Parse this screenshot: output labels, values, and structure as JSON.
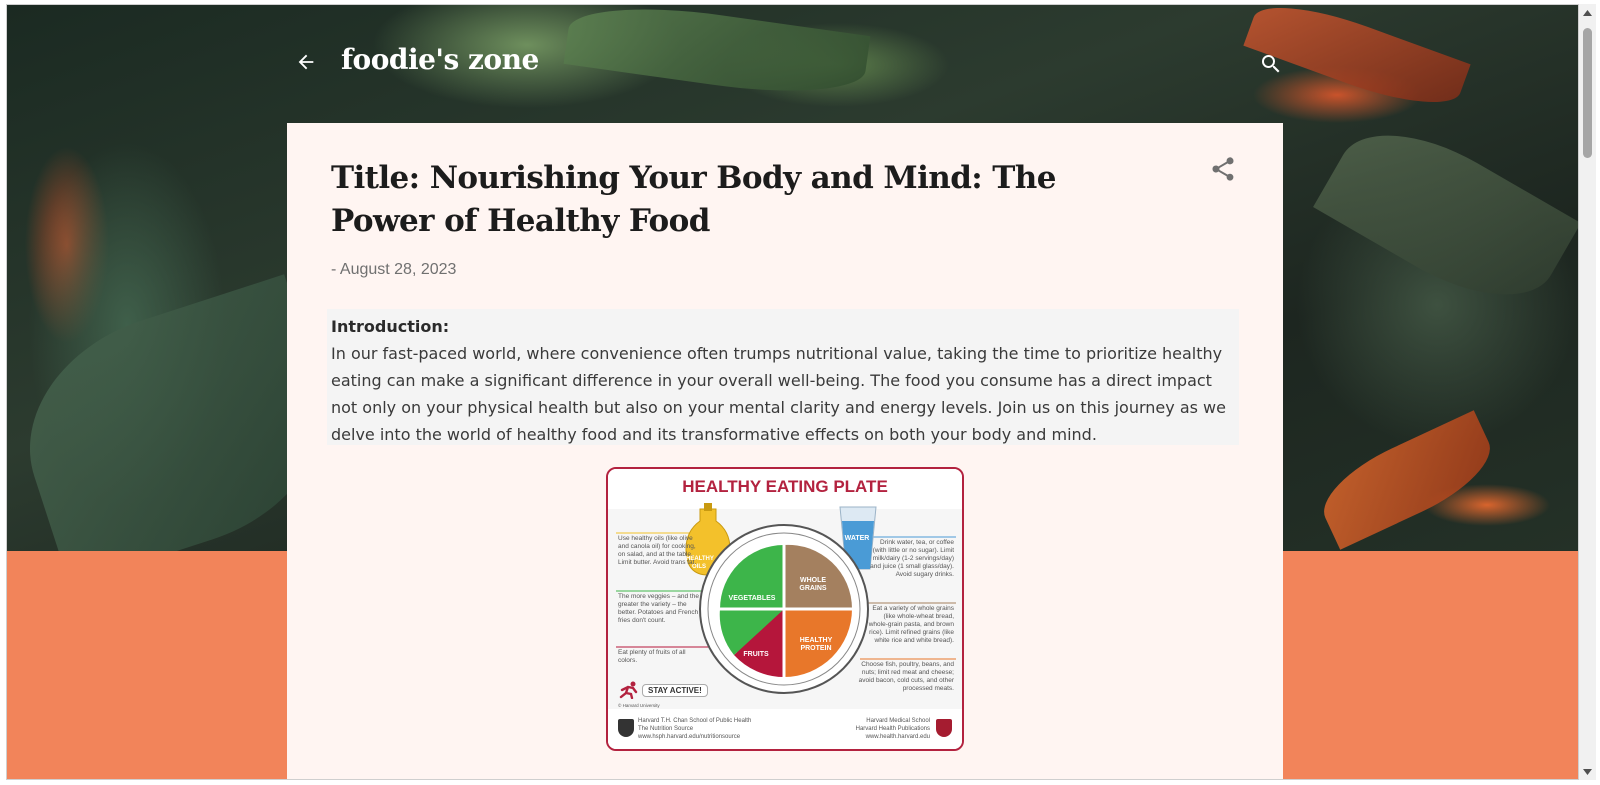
{
  "header": {
    "site_title": "foodie's zone"
  },
  "post": {
    "title": "Title: Nourishing Your Body and Mind: The Power of Healthy Food",
    "date": "- August 28, 2023",
    "intro_heading": "Introduction:",
    "intro_text": "In our fast-paced world, where convenience often trumps nutritional value, taking the time to prioritize healthy eating can make a significant difference in your overall well-being. The food you consume has a direct impact not only on your physical health but also on your mental clarity and energy levels. Join us on this journey as we delve into the world of healthy food and its transformative effects on both your body and mind."
  },
  "infographic": {
    "title": "HEALTHY EATING PLATE",
    "oils_label": "HEALTHY OILS",
    "water_label": "WATER",
    "vegetables_label": "VEGETABLES",
    "whole_grains_label": "WHOLE GRAINS",
    "fruits_label": "FRUITS",
    "protein_label": "HEALTHY PROTEIN",
    "oils_note": "Use healthy oils (like olive and canola oil) for cooking, on salad, and at the table. Limit butter. Avoid trans fat.",
    "veggies_note": "The more veggies – and the greater the variety – the better. Potatoes and French fries don't count.",
    "fruits_note": "Eat plenty of fruits of all colors.",
    "water_note": "Drink water, tea, or coffee (with little or no sugar). Limit milk/dairy (1-2 servings/day) and juice (1 small glass/day). Avoid sugary drinks.",
    "grains_note": "Eat a variety of whole grains (like whole-wheat bread, whole-grain pasta, and brown rice). Limit refined grains (like white rice and white bread).",
    "protein_note": "Choose fish, poultry, beans, and nuts; limit red meat and cheese; avoid bacon, cold cuts, and other processed meats.",
    "stay_active": "STAY ACTIVE!",
    "copyright": "© Harvard University",
    "left_footer": "Harvard T.H. Chan School of Public Health\nThe Nutrition Source\nwww.hsph.harvard.edu/nutritionsource",
    "right_footer": "Harvard Medical School\nHarvard Health Publications\nwww.health.harvard.edu",
    "colors": {
      "vegetables": "#3db54a",
      "whole_grains": "#a4805f",
      "fruits": "#b5163b",
      "protein": "#e8772a",
      "oil": "#f3c12b",
      "water": "#4a9bd6",
      "title": "#b3223f"
    }
  },
  "icons": {
    "back": "arrow-left-icon",
    "search": "search-icon",
    "share": "share-icon"
  },
  "theme": {
    "card_bg": "#fff5f2",
    "accent_band": "#f2845a"
  }
}
